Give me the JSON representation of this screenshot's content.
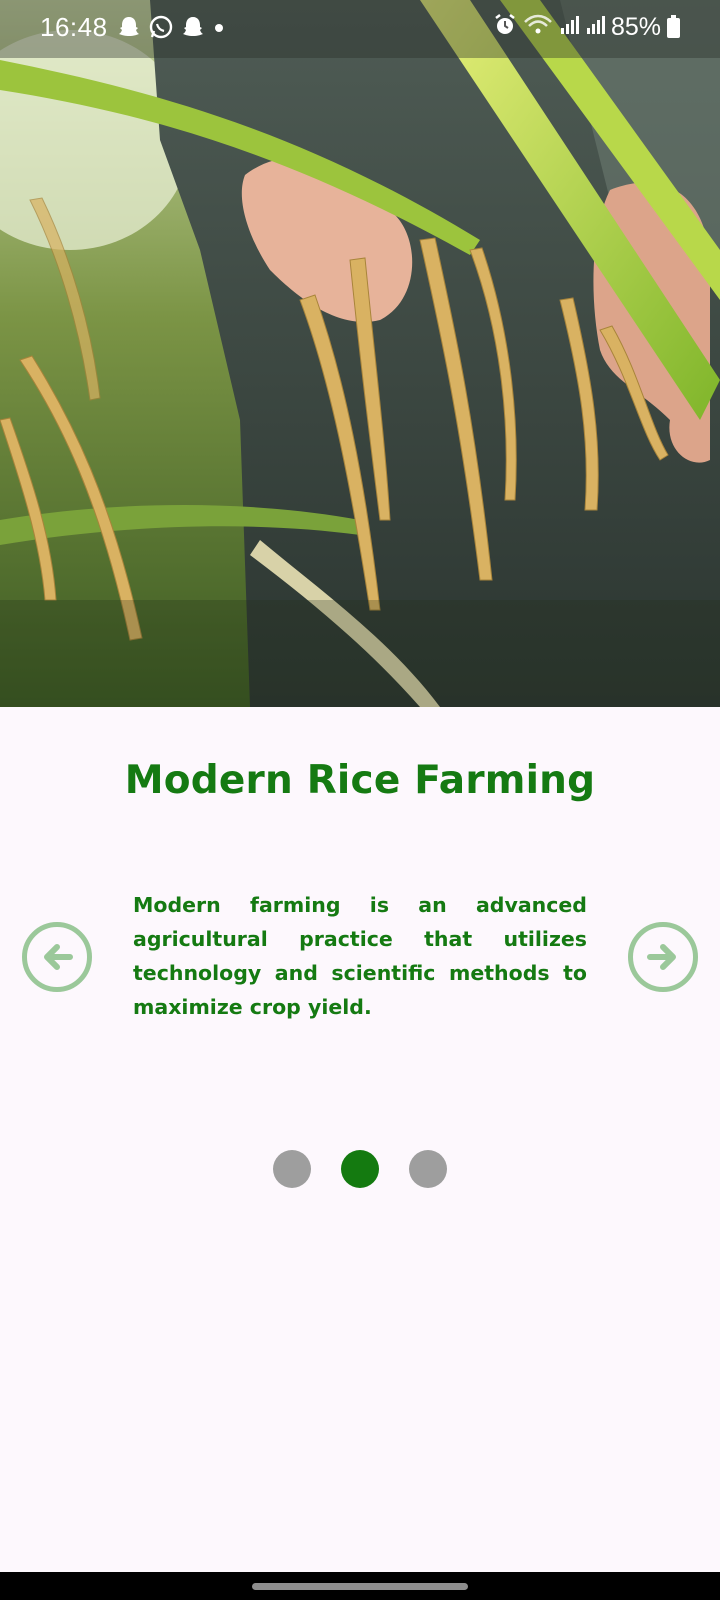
{
  "status_bar": {
    "time": "16:48",
    "battery": "85%",
    "left_icons": [
      "snapchat-icon",
      "whatsapp-icon",
      "snapchat-icon",
      "dot-icon"
    ],
    "right_icons": [
      "alarm-icon",
      "wifi-icon",
      "signal-icon",
      "signal-icon",
      "battery-icon"
    ]
  },
  "slide": {
    "title": "Modern Rice Farming",
    "description": "Modern farming is an advanced agricultural practice that utilizes technology and scientific methods to maximize crop yield.",
    "current_index": 2,
    "total": 3
  },
  "nav": {
    "prev_icon": "arrow-left-icon",
    "next_icon": "arrow-right-icon"
  },
  "colors": {
    "accent": "#157a12",
    "nav_ring": "#9bc89a",
    "dot_inactive": "#9e9e9e",
    "background": "#fdf8fd"
  }
}
